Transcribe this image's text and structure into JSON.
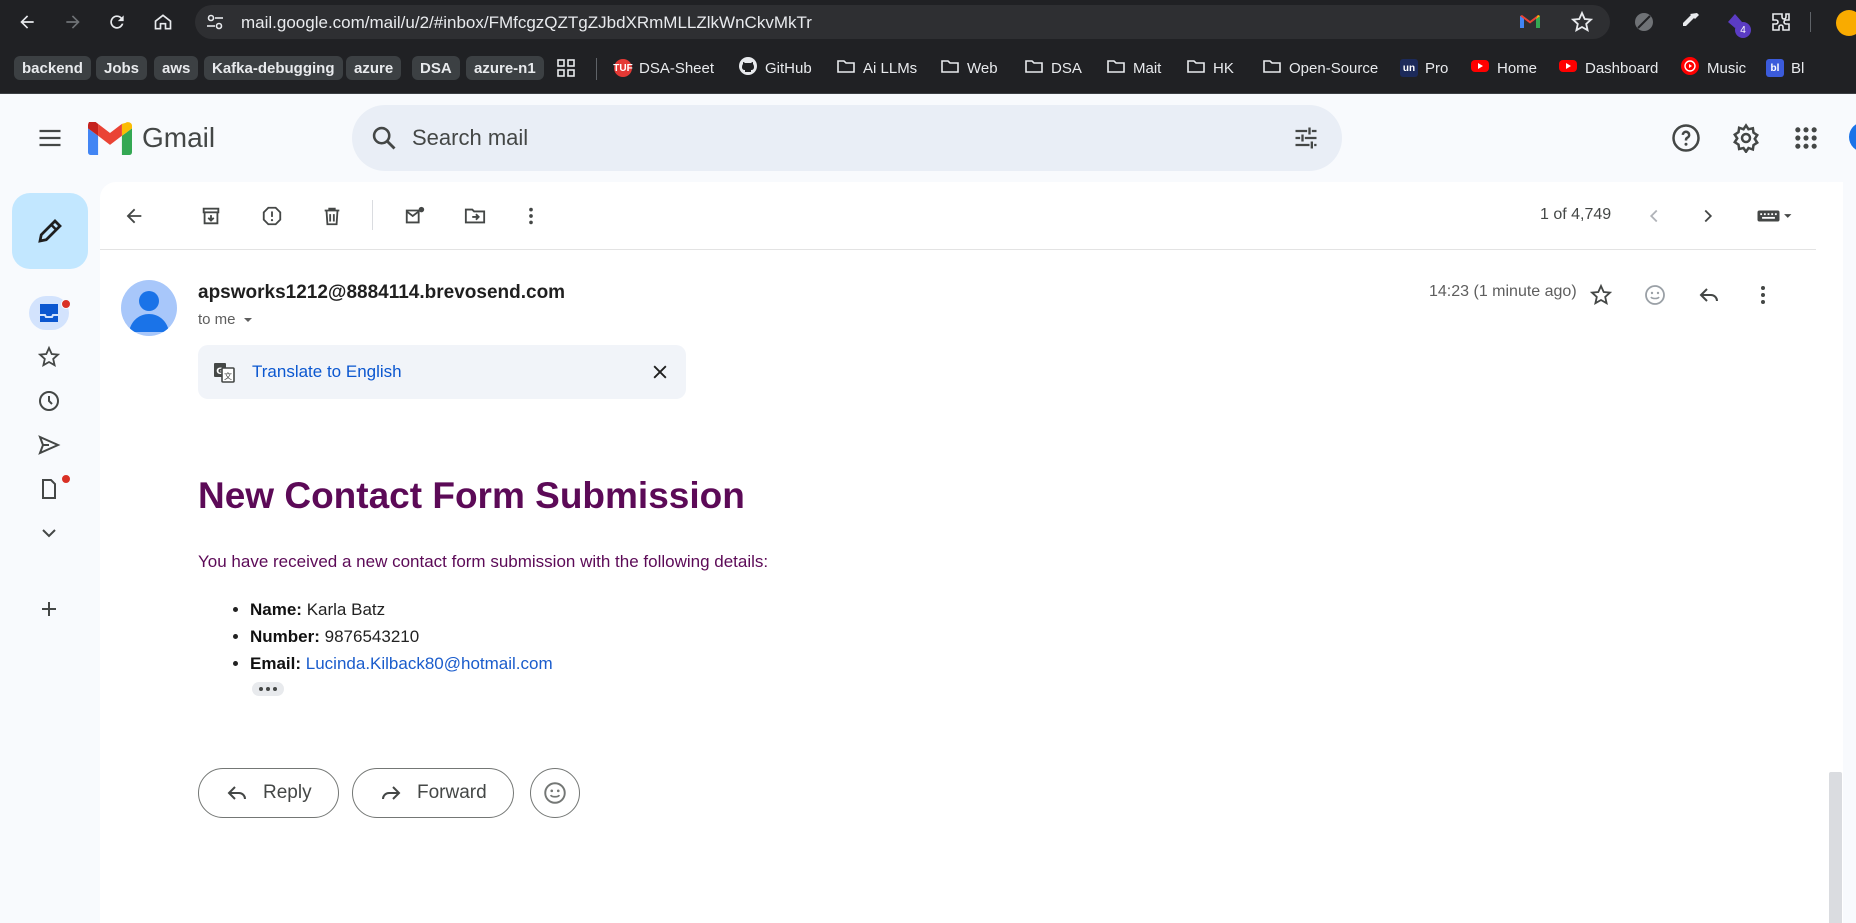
{
  "browser": {
    "url": "mail.google.com/mail/u/2/#inbox/FMfcgzQZTgZJbdXRmMLLZlkWnCkvMkTr",
    "extension_badge": "4"
  },
  "bookmarks": [
    {
      "label": "backend",
      "type": "chip"
    },
    {
      "label": "Jobs",
      "type": "chip"
    },
    {
      "label": "aws",
      "type": "chip"
    },
    {
      "label": "Kafka-debugging",
      "type": "chip"
    },
    {
      "label": "azure",
      "type": "chip"
    },
    {
      "label": "DSA",
      "type": "chip"
    },
    {
      "label": "azure-n1",
      "type": "chip"
    },
    {
      "label": "DSA-Sheet",
      "icon": "tuf-icon"
    },
    {
      "label": "GitHub",
      "icon": "github-icon"
    },
    {
      "label": "Ai LLMs",
      "icon": "folder-icon"
    },
    {
      "label": "Web",
      "icon": "folder-icon"
    },
    {
      "label": "DSA",
      "icon": "folder-icon"
    },
    {
      "label": "Mait",
      "icon": "folder-icon"
    },
    {
      "label": "HK",
      "icon": "folder-icon"
    },
    {
      "label": "Open-Source",
      "icon": "folder-icon"
    },
    {
      "label": "Pro",
      "icon": "un-icon"
    },
    {
      "label": "Home",
      "icon": "youtube-icon"
    },
    {
      "label": "Dashboard",
      "icon": "youtube-icon"
    },
    {
      "label": "Music",
      "icon": "ytmusic-icon"
    },
    {
      "label": "Bl",
      "icon": "bl-icon"
    }
  ],
  "bookmark_favicons": {
    "tuf": "TUF",
    "un": "un",
    "bl": "bl"
  },
  "gmail": {
    "logo_text": "Gmail",
    "search_placeholder": "Search mail"
  },
  "toolbar": {
    "page_count": "1 of 4,749"
  },
  "message": {
    "sender": "apsworks1212@8884114.brevosend.com",
    "recipient_label": "to me",
    "timestamp": "14:23 (1 minute ago)",
    "translate_label": "Translate to English",
    "heading": "New Contact Form Submission",
    "intro": "You have received a new contact form submission with the following details:",
    "details": [
      {
        "key": "Name:",
        "value": "Karla Batz"
      },
      {
        "key": "Number:",
        "value": "9876543210"
      },
      {
        "key": "Email:",
        "value": "Lucinda.Kilback80@hotmail.com"
      }
    ]
  },
  "actions": {
    "reply_label": "Reply",
    "forward_label": "Forward"
  },
  "colors": {
    "compose_bg": "#c2e7ff",
    "heading_color": "#5c0a57",
    "link_color": "#1a5ccc",
    "unread_dot": "#d93025"
  }
}
